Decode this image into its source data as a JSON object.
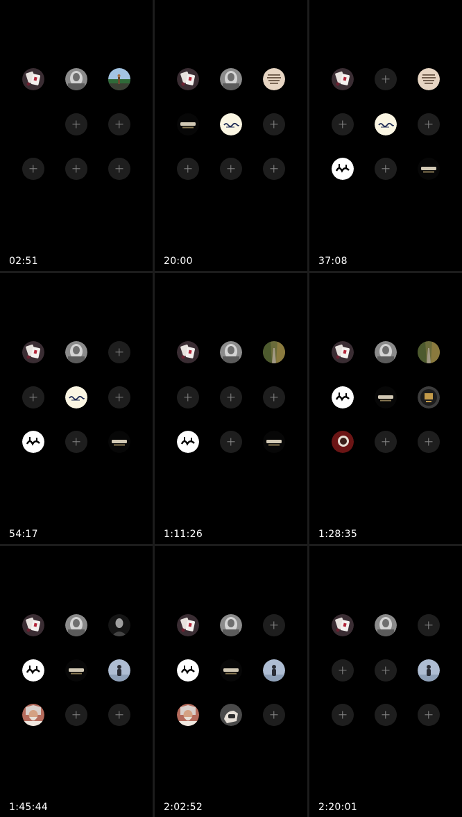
{
  "panels": [
    {
      "timestamp": "02:51",
      "slots": [
        "cards-avatar",
        "monochrome-portrait-avatar",
        "landscape-photo-avatar",
        "empty",
        "add",
        "add",
        "add",
        "add",
        "add"
      ]
    },
    {
      "timestamp": "20:00",
      "slots": [
        "cards-avatar",
        "monochrome-portrait-avatar",
        "beige-text-avatar",
        "dark-logo-avatar",
        "cream-script-avatar",
        "add",
        "add",
        "add",
        "add"
      ]
    },
    {
      "timestamp": "37:08",
      "slots": [
        "cards-avatar",
        "add",
        "beige-text-avatar",
        "add",
        "cream-script-avatar",
        "add",
        "white-calligraphy-avatar",
        "add",
        "dark-logo-avatar"
      ]
    },
    {
      "timestamp": "54:17",
      "slots": [
        "cards-avatar",
        "monochrome-portrait-avatar",
        "add",
        "add",
        "cream-script-avatar",
        "add",
        "white-calligraphy-avatar",
        "add",
        "dark-logo-avatar"
      ]
    },
    {
      "timestamp": "1:11:26",
      "slots": [
        "cards-avatar",
        "monochrome-portrait-avatar",
        "forest-road-avatar",
        "add",
        "add",
        "add",
        "white-calligraphy-avatar",
        "add",
        "dark-logo-avatar"
      ]
    },
    {
      "timestamp": "1:28:35",
      "slots": [
        "cards-avatar",
        "monochrome-portrait-avatar",
        "forest-road-avatar",
        "white-calligraphy-avatar",
        "dark-logo-avatar",
        "gold-emblem-avatar",
        "red-photo-avatar",
        "add",
        "add"
      ]
    },
    {
      "timestamp": "1:45:44",
      "slots": [
        "cards-avatar",
        "monochrome-portrait-avatar",
        "bw-portrait-avatar",
        "white-calligraphy-avatar",
        "dark-logo-avatar",
        "standing-figure-avatar",
        "portrait-face-avatar",
        "add",
        "add"
      ]
    },
    {
      "timestamp": "2:02:52",
      "slots": [
        "cards-avatar",
        "monochrome-portrait-avatar",
        "add",
        "white-calligraphy-avatar",
        "dark-logo-avatar",
        "standing-figure-avatar",
        "portrait-face-avatar",
        "hand-photo-avatar",
        "add"
      ]
    },
    {
      "timestamp": "2:20:01",
      "slots": [
        "cards-avatar",
        "monochrome-portrait-avatar",
        "add",
        "add",
        "add",
        "standing-figure-avatar",
        "add",
        "add",
        "add"
      ]
    }
  ]
}
